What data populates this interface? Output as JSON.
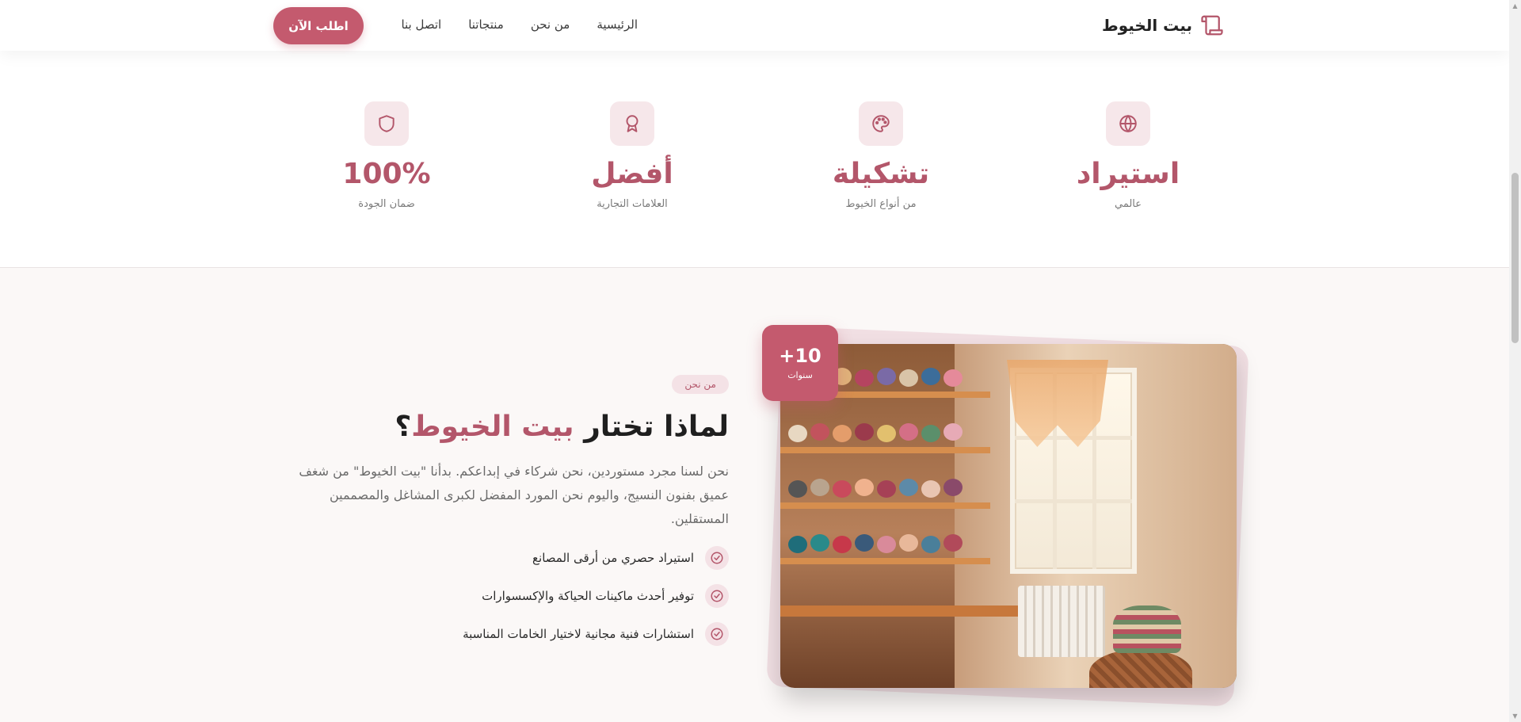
{
  "header": {
    "brand_name": "بيت الخيوط",
    "nav": [
      "الرئيسية",
      "من نحن",
      "منتجاتنا",
      "اتصل بنا"
    ],
    "cta_label": "اطلب الآن"
  },
  "stats": [
    {
      "icon": "globe-icon",
      "value": "استيراد",
      "label": "عالمي"
    },
    {
      "icon": "palette-icon",
      "value": "تشكيلة",
      "label": "من أنواع الخيوط"
    },
    {
      "icon": "award-icon",
      "value": "أفضل",
      "label": "العلامات التجارية"
    },
    {
      "icon": "shield-icon",
      "value": "100%",
      "label": "ضمان الجودة"
    }
  ],
  "about": {
    "tag": "من نحن",
    "title_prefix": "لماذا تختار",
    "title_accent": "بيت الخيوط",
    "title_suffix": "؟",
    "description": "نحن لسنا مجرد مستوردين، نحن شركاء في إبداعكم. بدأنا \"بيت الخيوط\" من شغف عميق بفنون النسيج، واليوم نحن المورد المفضل لكبرى المشاغل والمصممين المستقلين.",
    "features": [
      "استيراد حصري من أرقى المصانع",
      "توفير أحدث ماكينات الحياكة والإكسسوارات",
      "استشارات فنية مجانية لاختيار الخامات المناسبة"
    ],
    "badge_value": "+10",
    "badge_label": "سنوات"
  },
  "colors": {
    "accent": "#c45a6e",
    "accent_text": "#b3566a",
    "icon_bg": "#f6e7ea",
    "section_bg": "#fbf8f7"
  }
}
